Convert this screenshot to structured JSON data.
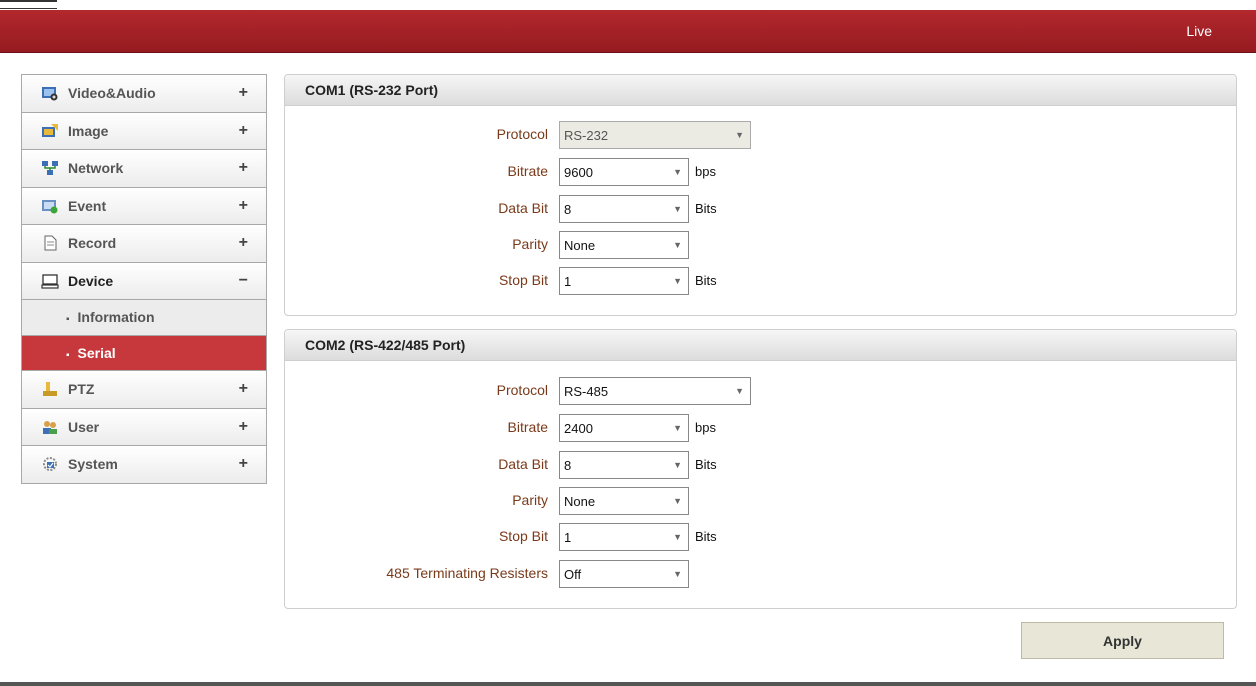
{
  "header": {
    "live_label": "Live"
  },
  "sidebar": {
    "items": [
      {
        "label": "Video&Audio",
        "sign": "+",
        "icon": "video-audio-icon"
      },
      {
        "label": "Image",
        "sign": "+",
        "icon": "image-icon"
      },
      {
        "label": "Network",
        "sign": "+",
        "icon": "network-icon"
      },
      {
        "label": "Event",
        "sign": "+",
        "icon": "event-icon"
      },
      {
        "label": "Record",
        "sign": "+",
        "icon": "record-icon"
      },
      {
        "label": "Device",
        "sign": "−",
        "icon": "device-icon"
      },
      {
        "label": "PTZ",
        "sign": "+",
        "icon": "ptz-icon"
      },
      {
        "label": "User",
        "sign": "+",
        "icon": "user-icon"
      },
      {
        "label": "System",
        "sign": "+",
        "icon": "system-icon"
      }
    ],
    "sub_items": [
      {
        "label": "Information",
        "bullet": "▪"
      },
      {
        "label": "Serial",
        "bullet": "▪"
      }
    ],
    "active_sub_color": "#c6383c"
  },
  "com1": {
    "title": "COM1 (RS-232 Port)",
    "protocol_label": "Protocol",
    "protocol_value": "RS-232",
    "bitrate_label": "Bitrate",
    "bitrate_value": "9600",
    "bitrate_unit": "bps",
    "databit_label": "Data Bit",
    "databit_value": "8",
    "databit_unit": "Bits",
    "parity_label": "Parity",
    "parity_value": "None",
    "stopbit_label": "Stop Bit",
    "stopbit_value": "1",
    "stopbit_unit": "Bits"
  },
  "com2": {
    "title": "COM2 (RS-422/485 Port)",
    "protocol_label": "Protocol",
    "protocol_value": "RS-485",
    "bitrate_label": "Bitrate",
    "bitrate_value": "2400",
    "bitrate_unit": "bps",
    "databit_label": "Data Bit",
    "databit_value": "8",
    "databit_unit": "Bits",
    "parity_label": "Parity",
    "parity_value": "None",
    "stopbit_label": "Stop Bit",
    "stopbit_value": "1",
    "stopbit_unit": "Bits",
    "term_label": "485 Terminating Resisters",
    "term_value": "Off"
  },
  "apply_label": "Apply",
  "colors": {
    "header": "#a52125",
    "accent": "#c6383c",
    "button": "#e8e6d6"
  }
}
